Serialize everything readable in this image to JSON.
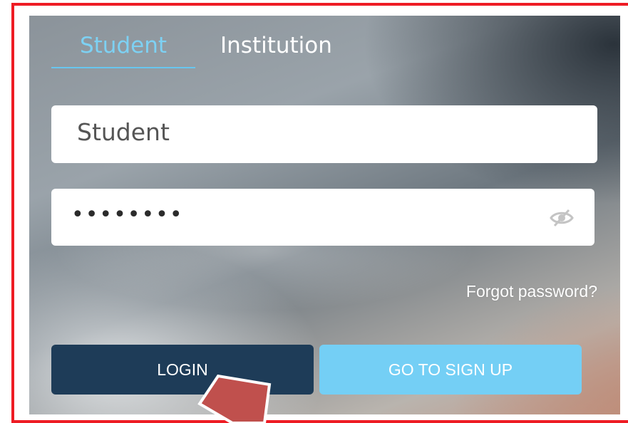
{
  "tabs": [
    {
      "label": "Student",
      "active": true
    },
    {
      "label": "Institution",
      "active": false
    }
  ],
  "username": {
    "value": "Student"
  },
  "password": {
    "masked_value": "••••••••"
  },
  "icons": {
    "password_toggle": "eye-slash-icon",
    "annotation": "arrow-pointer-icon"
  },
  "forgot_password_label": "Forgot password?",
  "buttons": {
    "login_label": "LOGIN",
    "signup_label": "GO TO SIGN UP"
  },
  "colors": {
    "active_tab": "#7dd1f3",
    "login_button": "#1e3c58",
    "signup_button": "#74cff5",
    "highlight_border": "#ee1c24",
    "annotation_arrow": "#c0504d"
  }
}
